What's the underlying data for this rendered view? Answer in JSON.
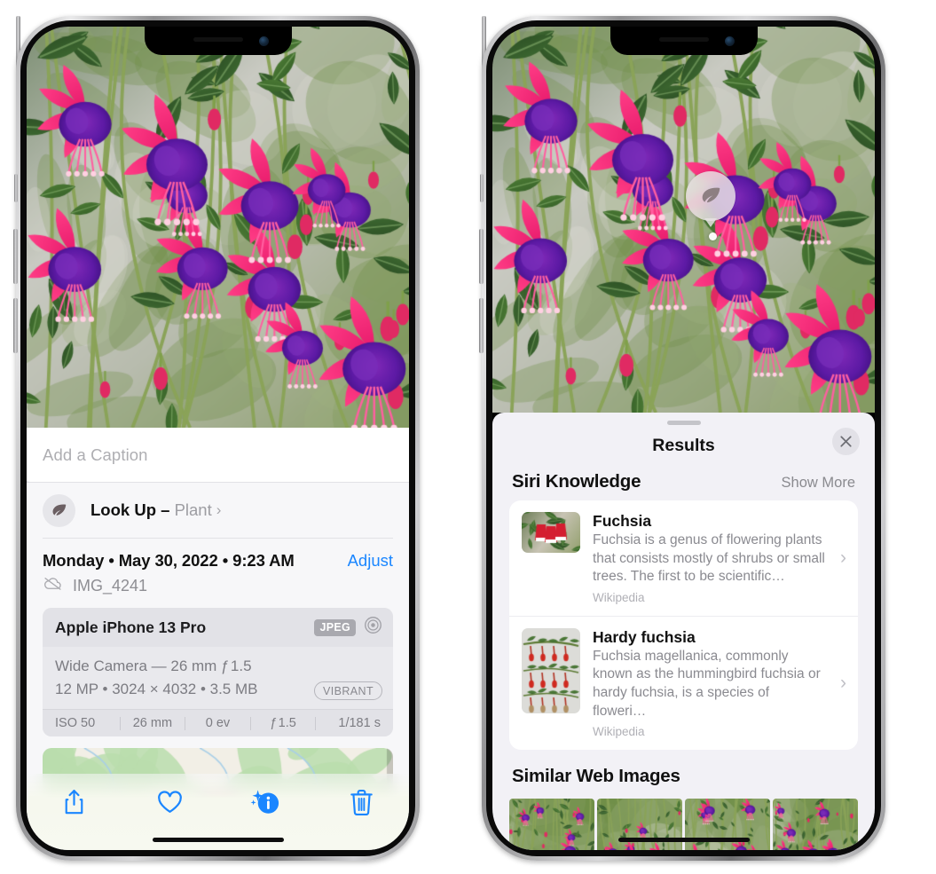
{
  "left_phone": {
    "caption": {
      "placeholder": "Add a Caption",
      "value": ""
    },
    "lookup": {
      "label": "Look Up – ",
      "subject": "Plant",
      "chevron": "›",
      "icon": "leaf-icon"
    },
    "date_row": {
      "date": "Monday • May 30, 2022 • 9:23 AM",
      "adjust_label": "Adjust"
    },
    "filename": {
      "icon": "cloud-slash-icon",
      "text": "IMG_4241"
    },
    "exif": {
      "model": "Apple iPhone 13 Pro",
      "format_badge": "JPEG",
      "aperture_icon": "aperture-icon",
      "lens_line": "Wide Camera — 26 mm ƒ 1.5",
      "size_line": "12 MP • 3024 × 4032 • 3.5 MB",
      "style_badge": "VIBRANT",
      "stats": [
        "ISO 50",
        "26 mm",
        "0 ev",
        "ƒ 1.5",
        "1/181 s"
      ]
    },
    "toolbar": [
      {
        "name": "share-button",
        "icon": "share-icon"
      },
      {
        "name": "favorite-button",
        "icon": "heart-icon"
      },
      {
        "name": "info-button",
        "icon": "info-sparkle-icon"
      },
      {
        "name": "delete-button",
        "icon": "trash-icon"
      }
    ]
  },
  "right_phone": {
    "visual_lookup_badge": {
      "icon": "leaf-icon"
    },
    "sheet": {
      "title": "Results",
      "close_icon": "close-icon",
      "grabber": "grabber-handle"
    },
    "siri_knowledge": {
      "heading": "Siri Knowledge",
      "show_more": "Show More",
      "results": [
        {
          "title": "Fuchsia",
          "description": "Fuchsia is a genus of flowering plants that consists mostly of shrubs or small trees. The first to be scientific…",
          "source": "Wikipedia",
          "chevron": "›"
        },
        {
          "title": "Hardy fuchsia",
          "description": "Fuchsia magellanica, commonly known as the hummingbird fuchsia or hardy fuchsia, is a species of floweri…",
          "source": "Wikipedia",
          "chevron": "›"
        }
      ]
    },
    "similar_web_images": {
      "heading": "Similar Web Images",
      "count": 4
    }
  },
  "colors": {
    "accent_blue": "#1a86ff",
    "sheet_bg": "#f2f1f6",
    "card_bg": "#ffffff",
    "exif_bg": "#e9e9ed",
    "secondary_text": "#8a8a90"
  }
}
